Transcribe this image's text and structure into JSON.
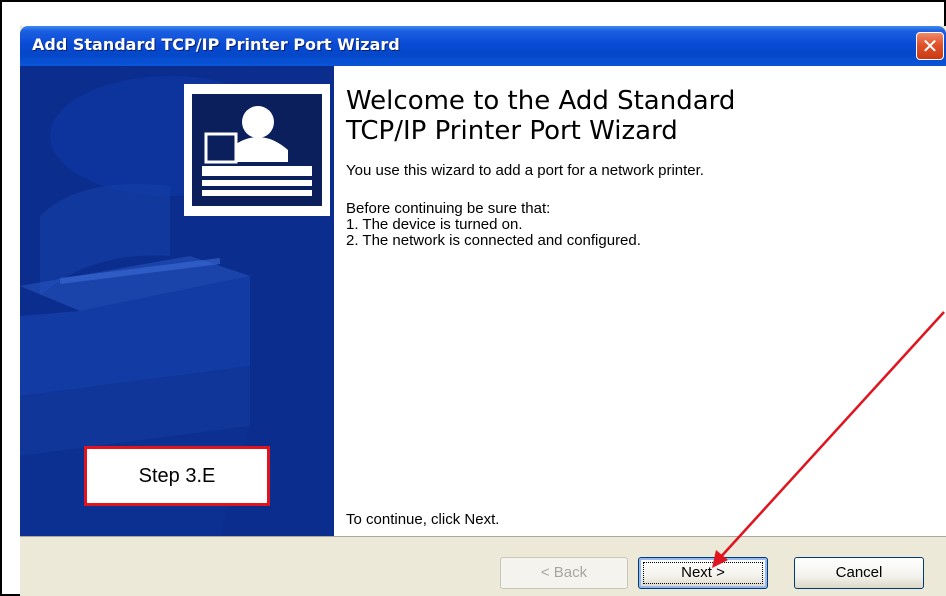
{
  "window": {
    "title": "Add Standard TCP/IP Printer Port Wizard",
    "close_icon": "close-icon"
  },
  "sidebar": {
    "graphic": "printer-icon",
    "annotation_label": "Step 3.E",
    "annotation_border_color": "#e0141e"
  },
  "content": {
    "heading_line1": "Welcome to the Add Standard",
    "heading_line2": "TCP/IP Printer Port Wizard",
    "intro": "You use this wizard to add a port for a network printer.",
    "before_heading": "Before continuing be sure that:",
    "conditions": [
      "1.  The device is turned on.",
      "2.  The network is connected and configured."
    ],
    "continue_text": "To continue, click Next."
  },
  "buttons": {
    "back_label": "< Back",
    "next_label": "Next >",
    "cancel_label": "Cancel",
    "back_enabled": false
  },
  "annotation_arrow": {
    "color": "#e0141e",
    "points_to": "next-button"
  }
}
